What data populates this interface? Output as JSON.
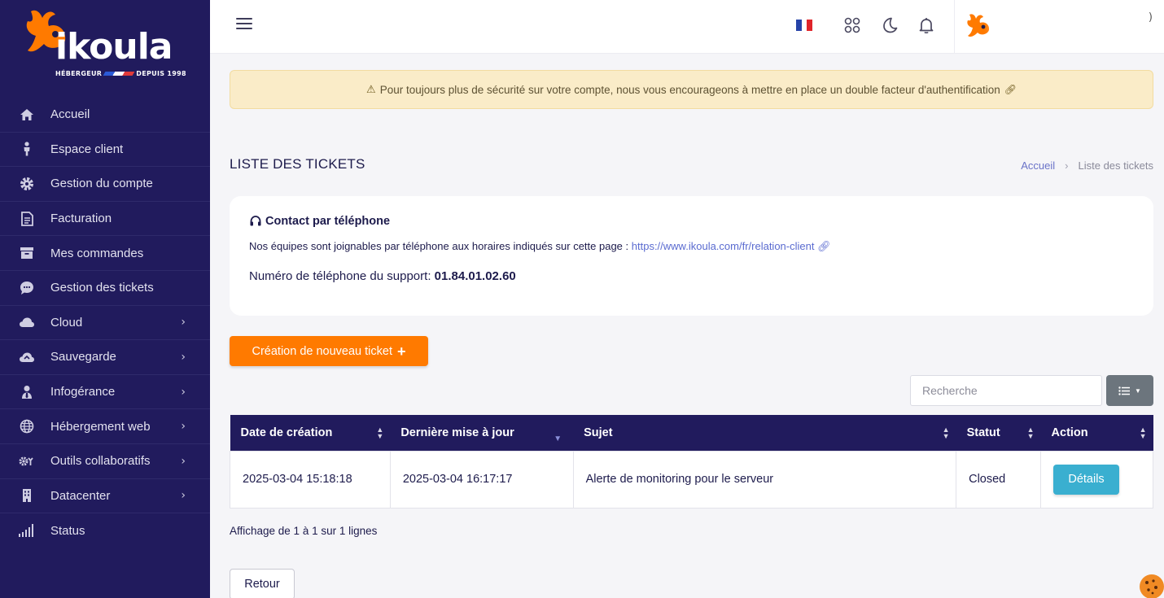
{
  "brand": {
    "name": "ikoula",
    "tagline_left": "HÉBERGEUR",
    "tagline_right": "DEPUIS 1998",
    "accent": "#ff7a00",
    "navy": "#211b5d"
  },
  "sidebar": {
    "items": [
      {
        "label": "Accueil",
        "icon": "home-icon",
        "chevron": false
      },
      {
        "label": "Espace client",
        "icon": "person-icon",
        "chevron": false
      },
      {
        "label": "Gestion du compte",
        "icon": "gear-icon",
        "chevron": false
      },
      {
        "label": "Facturation",
        "icon": "invoice-icon",
        "chevron": false
      },
      {
        "label": "Mes commandes",
        "icon": "archive-icon",
        "chevron": false
      },
      {
        "label": "Gestion des tickets",
        "icon": "chat-icon",
        "chevron": false
      },
      {
        "label": "Cloud",
        "icon": "cloud-icon",
        "chevron": true
      },
      {
        "label": "Sauvegarde",
        "icon": "cloud-backup-icon",
        "chevron": true
      },
      {
        "label": "Infogérance",
        "icon": "user-tie-icon",
        "chevron": true
      },
      {
        "label": "Hébergement web",
        "icon": "globe-icon",
        "chevron": true
      },
      {
        "label": "Outils collaboratifs",
        "icon": "tools-icon",
        "chevron": true
      },
      {
        "label": "Datacenter",
        "icon": "building-icon",
        "chevron": true
      },
      {
        "label": "Status",
        "icon": "signal-icon",
        "chevron": false
      }
    ]
  },
  "header": {
    "user_suffix": ")"
  },
  "alert": {
    "text": "Pour toujours plus de sécurité sur votre compte, nous vous encourageons à mettre en place un double facteur d'authentification"
  },
  "page": {
    "title": "LISTE DES TICKETS",
    "breadcrumb": {
      "home": "Accueil",
      "current": "Liste des tickets"
    }
  },
  "contact": {
    "title": "Contact par téléphone",
    "text": "Nos équipes sont joignables par téléphone aux horaires indiqués sur cette page :",
    "link": "https://www.ikoula.com/fr/relation-client",
    "phone_label": "Numéro de téléphone du support:",
    "phone_number": "01.84.01.02.60"
  },
  "actions": {
    "create_ticket": "Création de nouveau ticket",
    "search_placeholder": "Recherche",
    "back": "Retour"
  },
  "table": {
    "columns": [
      "Date de création",
      "Dernière mise à jour",
      "Sujet",
      "Statut",
      "Action"
    ],
    "rows": [
      {
        "created": "2025-03-04 15:18:18",
        "updated": "2025-03-04 16:17:17",
        "subject": "Alerte de monitoring pour le serveur",
        "status": "Closed",
        "action": "Détails"
      }
    ],
    "footer": "Affichage de 1 à 1 sur 1 lignes"
  }
}
